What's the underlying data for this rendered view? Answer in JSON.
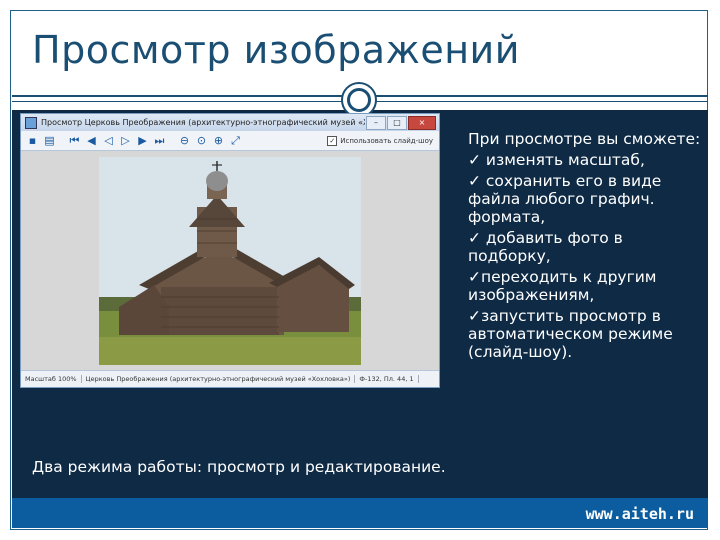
{
  "slide": {
    "title": "Просмотр изображений",
    "footer_url": "www.aiteh.ru",
    "bottom_text": "Два режима работы: просмотр и редактирование.",
    "intro": "При просмотре вы сможете:",
    "bullets": [
      "✓ изменять масштаб,",
      "✓ сохранить его в виде файла любого графич. формата,",
      "✓ добавить фото в подборку,",
      "✓переходить к другим изображениям,",
      "✓запустить просмотр в автоматическом режиме (слайд-шоу)."
    ]
  },
  "screenshot_window": {
    "title": "Просмотр Церковь Преображения (архитектурно-этнографический музей «Хохловка»)",
    "controls": [
      "–",
      "□",
      "×"
    ],
    "slideshow_label": "Использовать слайд-шоу",
    "status": {
      "zoom": "Масштаб 100%",
      "caption": "Церковь Преображения (архитектурно-этнографический музей «Хохловка»)",
      "id": "Ф-132, Пл. 44, 1",
      "path": ""
    },
    "colors": {
      "sky": "#d9e3ea",
      "wood": "#6b5646",
      "grass": "#7a8f3e"
    }
  }
}
